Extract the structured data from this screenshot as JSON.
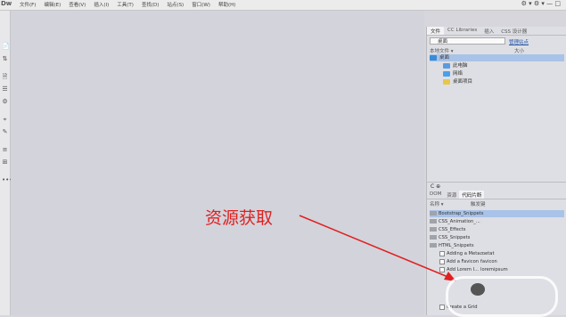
{
  "app": {
    "logo": "Dw"
  },
  "menu": [
    "文件(F)",
    "编辑(E)",
    "查看(V)",
    "插入(I)",
    "工具(T)",
    "查找(D)",
    "站点(S)",
    "窗口(W)",
    "帮助(H)"
  ],
  "window_controls": "⚙ ▾  ⚙ ▾  —  □",
  "left_toolbar_icons": [
    "📄",
    "⇅",
    "🗎",
    "☰",
    "⚙",
    "⌖",
    "✎",
    "≡",
    "⊞",
    "•••"
  ],
  "files_panel": {
    "tabs": [
      "文件",
      "CC Libraries",
      "插入",
      "CSS 设计器"
    ],
    "active_tab": "文件",
    "location_select": "桌面",
    "manage_sites_link": "管理站点",
    "header_local": "本地文件 ▾",
    "header_size": "大小",
    "tree": [
      {
        "label": "桌面",
        "level": 0,
        "selected": true
      },
      {
        "label": "此电脑",
        "level": 1
      },
      {
        "label": "网络",
        "level": 1
      },
      {
        "label": "桌面项目",
        "level": 1
      }
    ]
  },
  "bottom_icons": "C ⊕",
  "snippets_panel": {
    "tabs": [
      "DOM",
      "资源",
      "代码片断"
    ],
    "active_tab": "代码片断",
    "col_name": "名称 ▾",
    "col_trigger": "触发键",
    "rows": [
      {
        "label": "Bootstrap_Snippets",
        "type": "folder",
        "indent": 0,
        "selected": true
      },
      {
        "label": "CSS_Animation_...",
        "type": "folder",
        "indent": 0
      },
      {
        "label": "CSS_Effects",
        "type": "folder",
        "indent": 0
      },
      {
        "label": "CSS_Snippets",
        "type": "folder",
        "indent": 0
      },
      {
        "label": "HTML_Snippets",
        "type": "folder",
        "indent": 0
      },
      {
        "label": "Adding a Meta...",
        "trigger": "metat",
        "type": "doc",
        "indent": 1
      },
      {
        "label": "Add a Favicon",
        "trigger": "favicon",
        "type": "doc",
        "indent": 1
      },
      {
        "label": "Add Lorem I...",
        "trigger": "loremipsum",
        "type": "doc",
        "indent": 1
      },
      {
        "label": "Create a Grid",
        "trigger": "",
        "type": "doc",
        "indent": 1
      }
    ]
  },
  "annotation": "资源获取"
}
